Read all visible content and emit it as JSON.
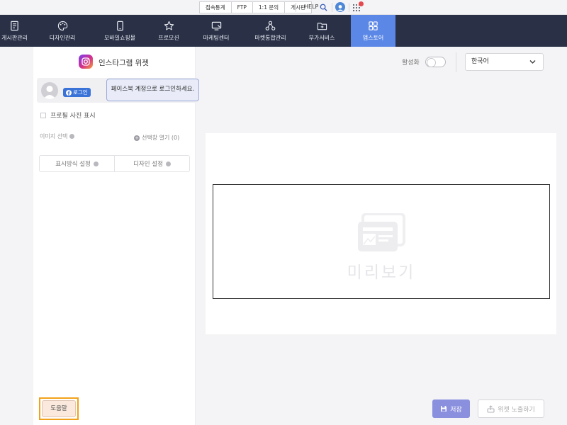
{
  "topbar": {
    "links": [
      "접속통계",
      "FTP",
      "1:1 문의",
      "게시판"
    ],
    "help_label": "HELP",
    "icons": [
      "search-icon",
      "user-avatar-icon",
      "app-grid-icon"
    ]
  },
  "nav": {
    "items": [
      {
        "label": "게시판관리",
        "icon": "board-icon"
      },
      {
        "label": "디자인관리",
        "icon": "palette-icon"
      },
      {
        "label": "모바일쇼핑몰",
        "icon": "mobile-icon"
      },
      {
        "label": "프로모션",
        "icon": "star-icon"
      },
      {
        "label": "마케팅센터",
        "icon": "monitor-icon"
      },
      {
        "label": "마켓통합관리",
        "icon": "network-icon"
      },
      {
        "label": "부가서비스",
        "icon": "folder-plus-icon"
      },
      {
        "label": "앱스토어",
        "icon": "grid-icon"
      }
    ],
    "active_index": 7
  },
  "panel": {
    "title": "인스타그램 위젯",
    "facebook_login": "로그인",
    "login_tooltip": "페이스북 계정으로 로그인하세요.",
    "show_profile_photo": "프로필 사진 표시",
    "image_select": "이미지 선택",
    "open_selection": "선택창 열기 (0)",
    "tabs": [
      "표시방식 설정",
      "디자인 설정"
    ],
    "help_button": "도움말"
  },
  "controls": {
    "activate_label": "활성화",
    "language": "한국어"
  },
  "preview": {
    "label": "미리보기"
  },
  "actions": {
    "save": "저장",
    "expose_widget": "위젯 노출하기"
  },
  "colors": {
    "nav_bg": "#2a3147",
    "nav_active": "#5b87e6",
    "save_button": "#8a8fde",
    "help_highlight": "#f2a21a",
    "facebook": "#3a73d8"
  }
}
